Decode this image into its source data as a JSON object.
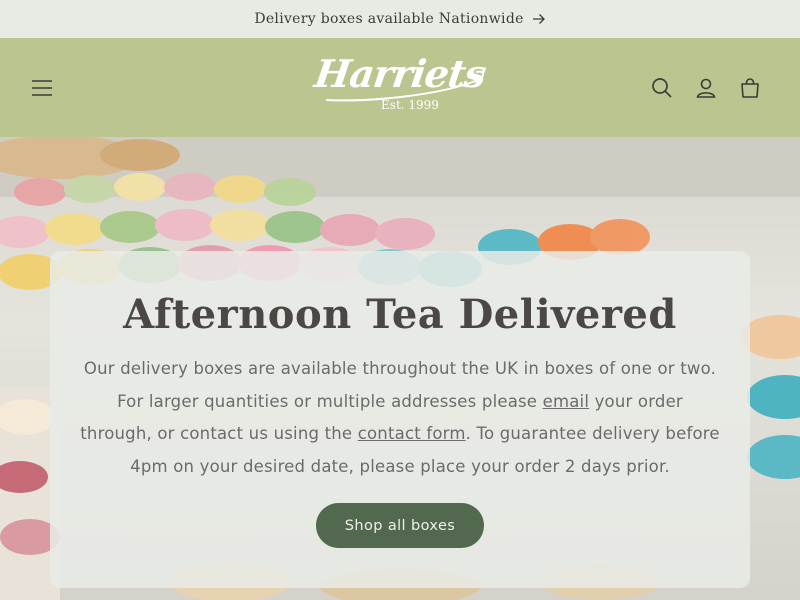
{
  "announcement": {
    "text": "Delivery boxes available Nationwide",
    "icon": "arrow-right-icon"
  },
  "header": {
    "logo_text": "Harriets",
    "logo_tagline": "Est. 1999",
    "icons": [
      "menu-icon",
      "search-icon",
      "account-icon",
      "cart-icon"
    ],
    "background_color": "#bbc58f"
  },
  "hero": {
    "title": "Afternoon Tea Delivered",
    "body_part1": "Our delivery boxes are available throughout the UK in boxes of one or two. For larger quantities or multiple addresses please ",
    "email_link": "email",
    "body_part2": " your order through, or contact us using the ",
    "contact_link": "contact form",
    "body_part3": ". To guarantee delivery before 4pm on your desired date, please place your order 2 days prior.",
    "button_label": "Shop all boxes",
    "button_color": "#52684f"
  }
}
